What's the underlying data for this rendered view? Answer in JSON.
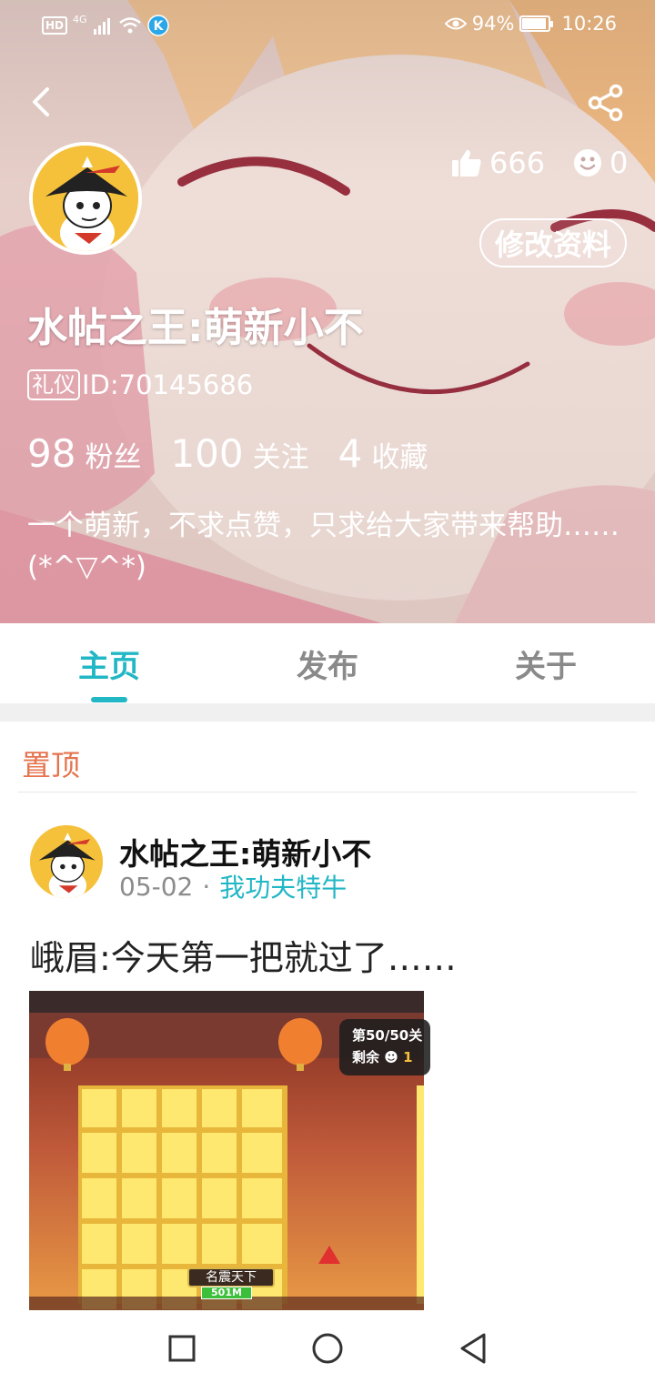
{
  "status_bar": {
    "hd": "HD",
    "network": "4G",
    "battery_pct_text": "94%",
    "battery_level": 0.94,
    "time": "10:26"
  },
  "profile": {
    "likes": "666",
    "faces": "0",
    "edit_label": "修改资料",
    "username": "水帖之王:萌新小不",
    "tag": "礼仪",
    "id_text": "ID:70145686",
    "stats": [
      {
        "num": "98",
        "label": "粉丝"
      },
      {
        "num": "100",
        "label": "关注"
      },
      {
        "num": "4",
        "label": "收藏"
      }
    ],
    "bio": "一个萌新，不求点赞，只求给大家带来帮助…… (*^▽^*)"
  },
  "tabs": [
    {
      "label": "主页",
      "active": true
    },
    {
      "label": "发布",
      "active": false
    },
    {
      "label": "关于",
      "active": false
    }
  ],
  "feed": {
    "section_title": "置顶",
    "post": {
      "author": "水帖之王:萌新小不",
      "date": "05-02",
      "separator": "·",
      "board": "我功夫特牛",
      "text": "峨眉:今天第一把就过了……",
      "image": {
        "level_line1": "第50/50关",
        "level_line2": "剩余",
        "remaining": "1",
        "sign": "名震天下",
        "bar_text": "501M"
      }
    }
  },
  "colors": {
    "accent": "#22b7c5",
    "pinned": "#e4744e",
    "avatar_bg": "#f5c13b"
  },
  "icons": [
    "back-icon",
    "share-icon",
    "thumbs-up-icon",
    "smiley-icon",
    "wifi-icon",
    "signal-icon",
    "battery-icon",
    "eye-icon",
    "square-nav-icon",
    "circle-nav-icon",
    "triangle-nav-icon"
  ]
}
